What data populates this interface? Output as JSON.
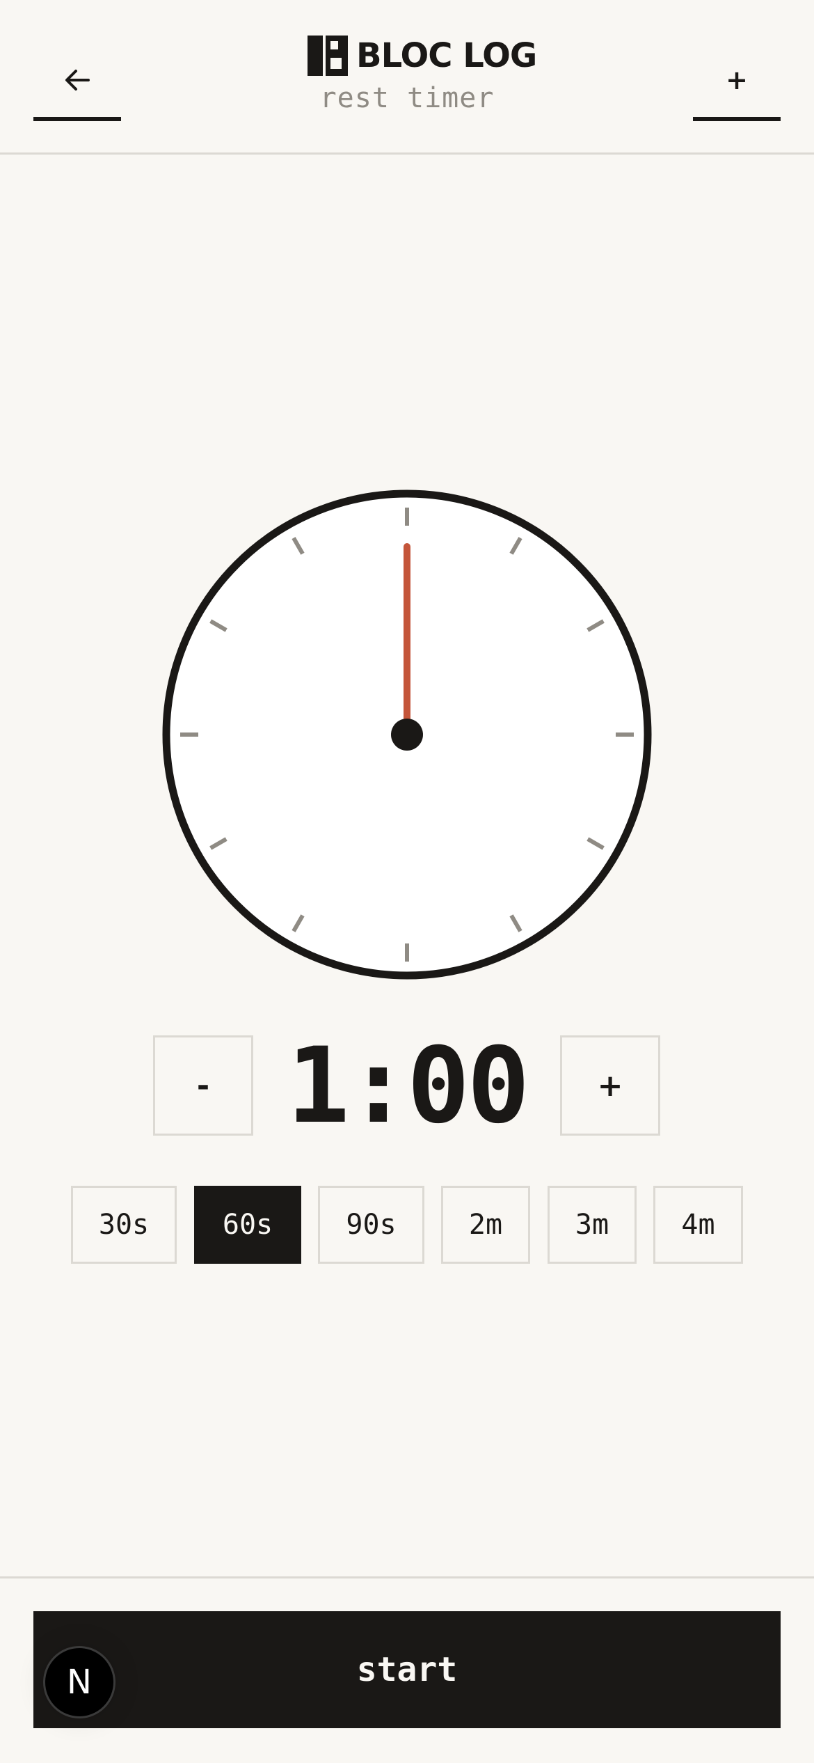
{
  "header": {
    "title": "BLOC LOG",
    "subtitle": "rest timer",
    "back_icon": "arrow-left-icon",
    "add_label": "+"
  },
  "timer": {
    "display": "1:00",
    "minus_label": "-",
    "plus_label": "+",
    "progress_fraction": 0
  },
  "presets": [
    {
      "label": "30s",
      "selected": false
    },
    {
      "label": "60s",
      "selected": true
    },
    {
      "label": "90s",
      "selected": false
    },
    {
      "label": "2m",
      "selected": false
    },
    {
      "label": "3m",
      "selected": false
    },
    {
      "label": "4m",
      "selected": false
    }
  ],
  "footer": {
    "start_label": "start",
    "badge_label": "N"
  },
  "colors": {
    "background": "#f9f7f3",
    "ink": "#1a1816",
    "accent_hand": "#c4553a",
    "muted": "#8f8b84",
    "border": "#dcd9d3"
  }
}
